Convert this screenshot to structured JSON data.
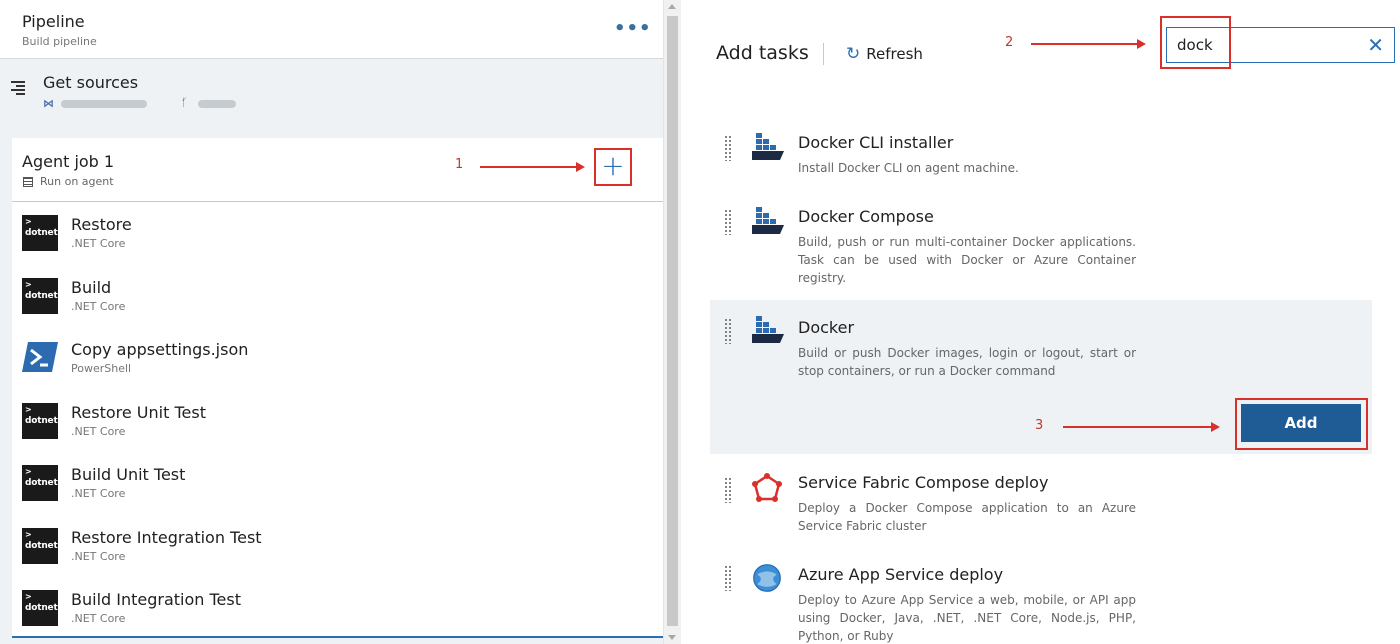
{
  "pipeline": {
    "title": "Pipeline",
    "subtitle": "Build pipeline",
    "more_label": "•••"
  },
  "sources": {
    "title": "Get sources"
  },
  "agent_job": {
    "title": "Agent job 1",
    "subtitle": "Run on agent",
    "add_label": "+"
  },
  "tasks": [
    {
      "name": "Restore",
      "sub": ".NET Core",
      "icon": "dotnet"
    },
    {
      "name": "Build",
      "sub": ".NET Core",
      "icon": "dotnet"
    },
    {
      "name": "Copy appsettings.json",
      "sub": "PowerShell",
      "icon": "powershell"
    },
    {
      "name": "Restore Unit Test",
      "sub": ".NET Core",
      "icon": "dotnet"
    },
    {
      "name": "Build Unit Test",
      "sub": ".NET Core",
      "icon": "dotnet"
    },
    {
      "name": "Restore Integration Test",
      "sub": ".NET Core",
      "icon": "dotnet"
    },
    {
      "name": "Build Integration Test",
      "sub": ".NET Core",
      "icon": "dotnet"
    }
  ],
  "dotnet_icon_text": "dotnet",
  "add_tasks": {
    "title": "Add tasks",
    "refresh_label": "Refresh",
    "search_value": "dock",
    "add_button_label": "Add"
  },
  "task_list": [
    {
      "name": "Docker CLI installer",
      "desc": "Install Docker CLI on agent machine.",
      "icon": "docker-icon"
    },
    {
      "name": "Docker Compose",
      "desc": "Build, push or run multi-container Docker applications. Task can be used with Docker or Azure Container registry.",
      "icon": "docker-icon"
    },
    {
      "name": "Docker",
      "desc": "Build or push Docker images, login or logout, start or stop containers, or run a Docker command",
      "icon": "docker-icon"
    },
    {
      "name": "Service Fabric Compose deploy",
      "desc": "Deploy a Docker Compose application to an Azure Service Fabric cluster",
      "icon": "service-fabric-icon"
    },
    {
      "name": "Azure App Service deploy",
      "desc": "Deploy to Azure App Service a web, mobile, or API app using Docker, Java, .NET, .NET Core, Node.js, PHP, Python, or Ruby",
      "icon": "azure-app-service-icon"
    }
  ],
  "annotations": {
    "step1": "1",
    "step2": "2",
    "step3": "3"
  },
  "colors": {
    "accent": "#2a6fb6",
    "annotation_red": "#d9302c",
    "add_button": "#1f5b94"
  }
}
